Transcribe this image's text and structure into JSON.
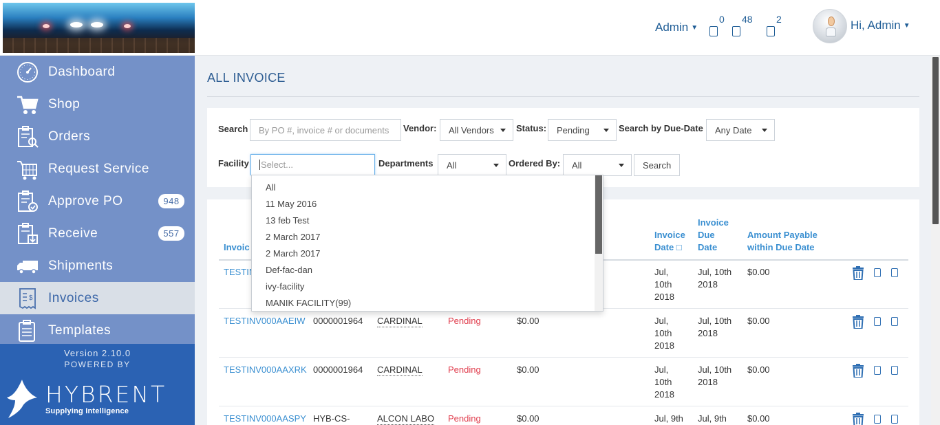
{
  "header": {
    "admin_menu": "Admin",
    "notifications": [
      {
        "icon": "notification-icon",
        "count": "0"
      },
      {
        "icon": "message-icon",
        "count": "48"
      },
      {
        "icon": "task-icon",
        "count": "2"
      }
    ],
    "greeting": "Hi, Admin"
  },
  "sidebar": {
    "items": [
      {
        "label": "Dashboard",
        "icon": "dashboard-icon"
      },
      {
        "label": "Shop",
        "icon": "cart-icon"
      },
      {
        "label": "Orders",
        "icon": "orders-icon"
      },
      {
        "label": "Request Service",
        "icon": "request-service-icon"
      },
      {
        "label": "Approve PO",
        "icon": "approve-po-icon",
        "badge": "948"
      },
      {
        "label": "Receive",
        "icon": "receive-icon",
        "badge": "557"
      },
      {
        "label": "Shipments",
        "icon": "truck-icon"
      },
      {
        "label": "Invoices",
        "icon": "invoice-icon",
        "active": true
      },
      {
        "label": "Templates",
        "icon": "templates-icon"
      }
    ],
    "version": "Version 2.10.0",
    "powered_by": "POWERED BY",
    "brand_name": "HYBRENT",
    "brand_tagline": "Supplying Intelligence"
  },
  "page": {
    "title": "ALL INVOICE"
  },
  "filters": {
    "search_label": "Search",
    "search_placeholder": "By PO #, invoice # or documents",
    "vendor_label": "Vendor:",
    "vendor_value": "All Vendors",
    "status_label": "Status:",
    "status_value": "Pending",
    "due_date_label": "Search by Due-Date",
    "due_date_value": "Any Date",
    "facility_label": "Facility",
    "facility_placeholder": "Select...",
    "departments_label": "Departments",
    "departments_value": "All",
    "ordered_by_label": "Ordered By:",
    "ordered_by_value": "All",
    "search_button": "Search"
  },
  "facility_options": [
    "All",
    "11 May 2016",
    "13 feb Test",
    "2 March 2017",
    "2 March 2017",
    "Def-fac-dan",
    "ivy-facility",
    "MANIK FACILITY(99)"
  ],
  "table": {
    "headers": {
      "invoice": "Invoic",
      "invoice_date_1": "Invoice",
      "invoice_date_2": "Date □",
      "due_date_1": "Invoice",
      "due_date_2": "Due",
      "due_date_3": "Date",
      "payable_1": "Amount Payable",
      "payable_2": "within Due Date"
    },
    "rows": [
      {
        "invoice": "TESTIN",
        "po": "",
        "vendor": "",
        "status": "",
        "amount": "",
        "date_1": "Jul,",
        "date_2": "10th",
        "date_3": "2018",
        "due_1": "Jul, 10th",
        "due_2": "2018",
        "payable": "$0.00"
      },
      {
        "invoice": "TESTINV000AAEIW",
        "po": "0000001964",
        "vendor": "CARDINAL",
        "status": "Pending",
        "amount": "$0.00",
        "date_1": "Jul,",
        "date_2": "10th",
        "date_3": "2018",
        "due_1": "Jul, 10th",
        "due_2": "2018",
        "payable": "$0.00"
      },
      {
        "invoice": "TESTINV000AAXRK",
        "po": "0000001964",
        "vendor": "CARDINAL",
        "status": "Pending",
        "amount": "$0.00",
        "date_1": "Jul,",
        "date_2": "10th",
        "date_3": "2018",
        "due_1": "Jul, 10th",
        "due_2": "2018",
        "payable": "$0.00"
      },
      {
        "invoice": "TESTINV000AASPY",
        "po": "HYB-CS-",
        "vendor": "ALCON LABO",
        "status": "Pending",
        "amount": "$0.00",
        "date_1": "Jul, 9th",
        "date_2": "",
        "date_3": "",
        "due_1": "Jul, 9th",
        "due_2": "",
        "payable": "$0.00"
      }
    ]
  },
  "colors": {
    "sidebar": "#7491c8",
    "sidebar_footer": "#2b62b3",
    "accent": "#3a8fd1",
    "status_pending": "#e03c4c"
  }
}
